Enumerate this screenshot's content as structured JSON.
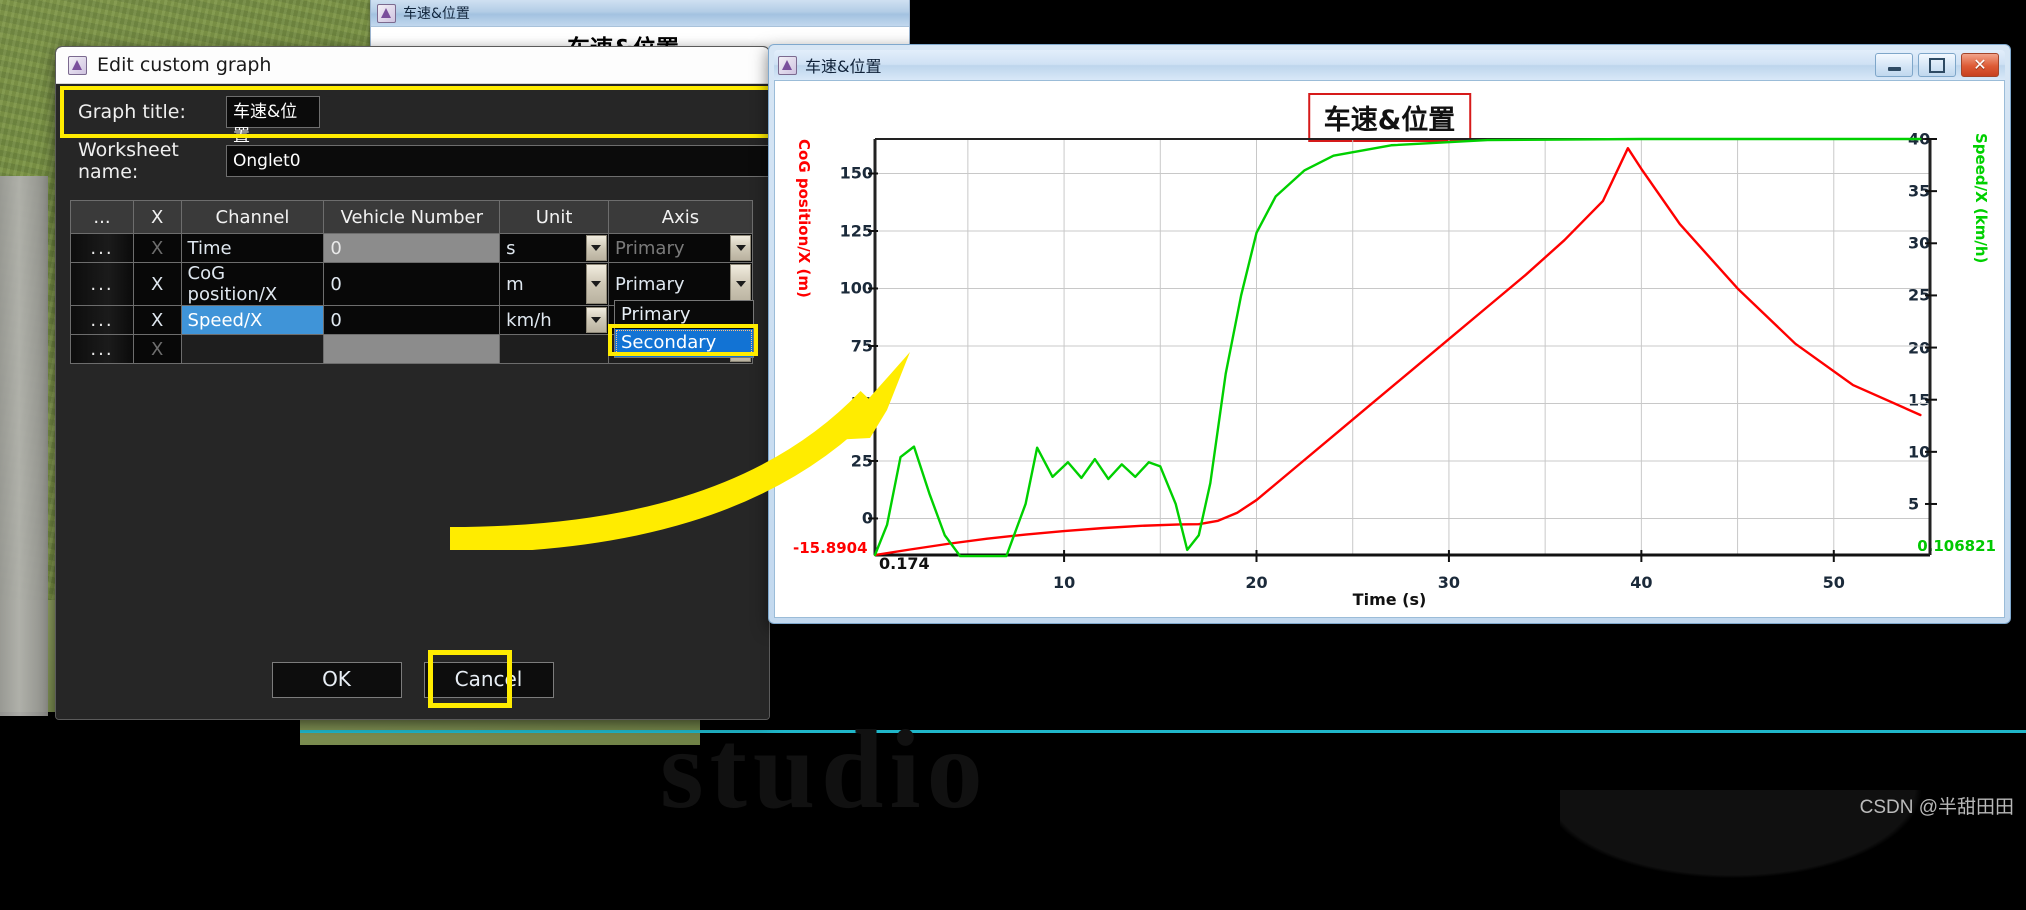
{
  "back_window": {
    "titlebar_text": "车速&位置",
    "heading": "车速&位置",
    "app_icon": "chart-app-icon"
  },
  "edit_dialog": {
    "title": "Edit custom graph",
    "app_icon": "chart-app-icon",
    "graph_title_label": "Graph title:",
    "graph_title_value": "车速&位置",
    "worksheet_label": "Worksheet name:",
    "worksheet_value": "Onglet0",
    "columns": [
      "...",
      "X",
      "Channel",
      "Vehicle Number",
      "Unit",
      "Axis"
    ],
    "rows": [
      {
        "dots": "...",
        "x": "X",
        "channel": "Time",
        "vehicle": "0",
        "unit": "s",
        "axis": "Primary",
        "dim": true,
        "selected": false,
        "vehicle_grey": true
      },
      {
        "dots": "...",
        "x": "X",
        "channel": "CoG position/X",
        "vehicle": "0",
        "unit": "m",
        "axis": "Primary",
        "dim": false,
        "selected": false,
        "vehicle_grey": false
      },
      {
        "dots": "...",
        "x": "X",
        "channel": "Speed/X",
        "vehicle": "0",
        "unit": "km/h",
        "axis": "Secondary",
        "dim": false,
        "selected": true,
        "vehicle_grey": false
      },
      {
        "dots": "...",
        "x": "X",
        "channel": "",
        "vehicle": "",
        "unit": "",
        "axis": "",
        "dim": true,
        "selected": false,
        "vehicle_grey": true
      }
    ],
    "axis_dropdown": {
      "options": [
        "Primary",
        "Secondary"
      ],
      "selected": "Secondary"
    },
    "ok_label": "OK",
    "cancel_label": "Cancel"
  },
  "chart_window": {
    "titlebar_text": "车速&位置",
    "app_icon": "chart-app-icon",
    "minimize_icon": "minimize-icon",
    "maximize_icon": "maximize-icon",
    "close_icon": "close-icon"
  },
  "watermarks": {
    "studio": "studio",
    "csdn": "CSDN @半甜田田"
  },
  "colors": {
    "highlight_yellow": "#ffec00",
    "title_box_red": "#d61a1a",
    "left_axis_red": "#ff0000",
    "right_axis_green": "#00d000",
    "selection_blue": "#3f94d8",
    "dropdown_blue": "#1273d4"
  },
  "chart_data": {
    "type": "line",
    "title": "车速&位置",
    "xlabel": "Time (s)",
    "ylabel": "CoG position/X (m)",
    "y2label": "Speed/X (km/h)",
    "grid": true,
    "legend": "none",
    "xlim": [
      0.174,
      55
    ],
    "xticks": [
      10,
      20,
      30,
      40,
      50
    ],
    "x_start_label": "0.174",
    "ylim": [
      -15.8904,
      165
    ],
    "yticks": [
      0,
      25,
      50,
      75,
      100,
      125,
      150
    ],
    "y_start_label": "-15.8904",
    "y2lim": [
      0.106821,
      40
    ],
    "y2ticks": [
      5,
      10,
      15,
      20,
      25,
      30,
      35,
      40
    ],
    "y2_start_label": "0.106821",
    "series": [
      {
        "name": "CoG position/X (m)",
        "axis": "primary",
        "color": "#ff0000",
        "unit": "m",
        "x": [
          0.174,
          2,
          4,
          6,
          8,
          10,
          12,
          14,
          16,
          17,
          18,
          19,
          20,
          22,
          24,
          26,
          28,
          30,
          32,
          34,
          36,
          38,
          39.3,
          40,
          42,
          45,
          48,
          51,
          54.5
        ],
        "y": [
          -15.89,
          -13.5,
          -11.0,
          -8.8,
          -7.0,
          -5.5,
          -4.2,
          -3.2,
          -2.6,
          -2.5,
          -1.0,
          2.5,
          8.0,
          22.0,
          36.0,
          50.0,
          64.0,
          78.0,
          92.0,
          106.0,
          121.0,
          138.0,
          161.0,
          152.0,
          128.0,
          100.0,
          76.0,
          58.0,
          45.0
        ]
      },
      {
        "name": "Speed/X (km/h)",
        "axis": "secondary",
        "color": "#00d000",
        "unit": "km/h",
        "x": [
          0.174,
          0.8,
          1.5,
          2.2,
          3.0,
          3.8,
          4.6,
          7.0,
          8.0,
          8.6,
          9.4,
          10.2,
          10.9,
          11.6,
          12.3,
          13.0,
          13.7,
          14.4,
          15.0,
          15.8,
          16.4,
          17.0,
          17.6,
          18.4,
          19.2,
          20.0,
          21.0,
          22.5,
          24.0,
          27.0,
          32.0,
          40.0,
          48.0,
          54.5
        ],
        "y": [
          0.11,
          3.0,
          9.5,
          10.5,
          6.0,
          2.0,
          0.0,
          0.0,
          5.0,
          10.4,
          7.6,
          9.0,
          7.5,
          9.3,
          7.4,
          8.8,
          7.6,
          9.0,
          8.6,
          5.0,
          0.6,
          2.0,
          7.0,
          17.5,
          25.0,
          31.0,
          34.5,
          37.0,
          38.4,
          39.4,
          39.9,
          40.0,
          40.0,
          40.0
        ]
      }
    ]
  }
}
